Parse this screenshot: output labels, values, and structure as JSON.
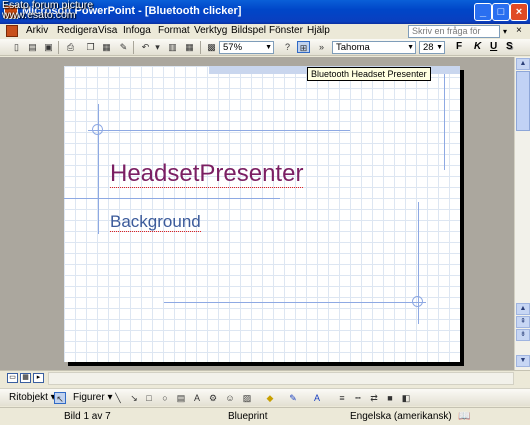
{
  "watermark": {
    "line1": "Esato forum picture",
    "line2": "www.esato.com"
  },
  "window": {
    "title": "Microsoft PowerPoint - [Bluetooth clicker]"
  },
  "menu": {
    "items": [
      "Arkiv",
      "Redigera",
      "Visa",
      "Infoga",
      "Format",
      "Verktyg",
      "Bildspel",
      "Fönster",
      "Hjälp"
    ],
    "help_placeholder": "Skriv en fråga för hjälp"
  },
  "toolbar": {
    "zoom": "57%",
    "font": "Tahoma",
    "font_size": "28",
    "bold": "F",
    "italic": "K",
    "underline": "U",
    "shadow": "S"
  },
  "tooltip": "Bluetooth Headset Presenter",
  "slide": {
    "title": "HeadsetPresenter",
    "subtitle": "Background"
  },
  "drawing_toolbar": {
    "draw_label": "Ritobjekt",
    "shapes_label": "Figurer"
  },
  "status": {
    "slide_info": "Bild 1 av 7",
    "design": "Blueprint",
    "language": "Engelska (amerikansk)"
  },
  "colors": {
    "title_color": "#7b1f63",
    "subtitle_color": "#3b5a9a",
    "titlebar": "#0a4fd0"
  }
}
